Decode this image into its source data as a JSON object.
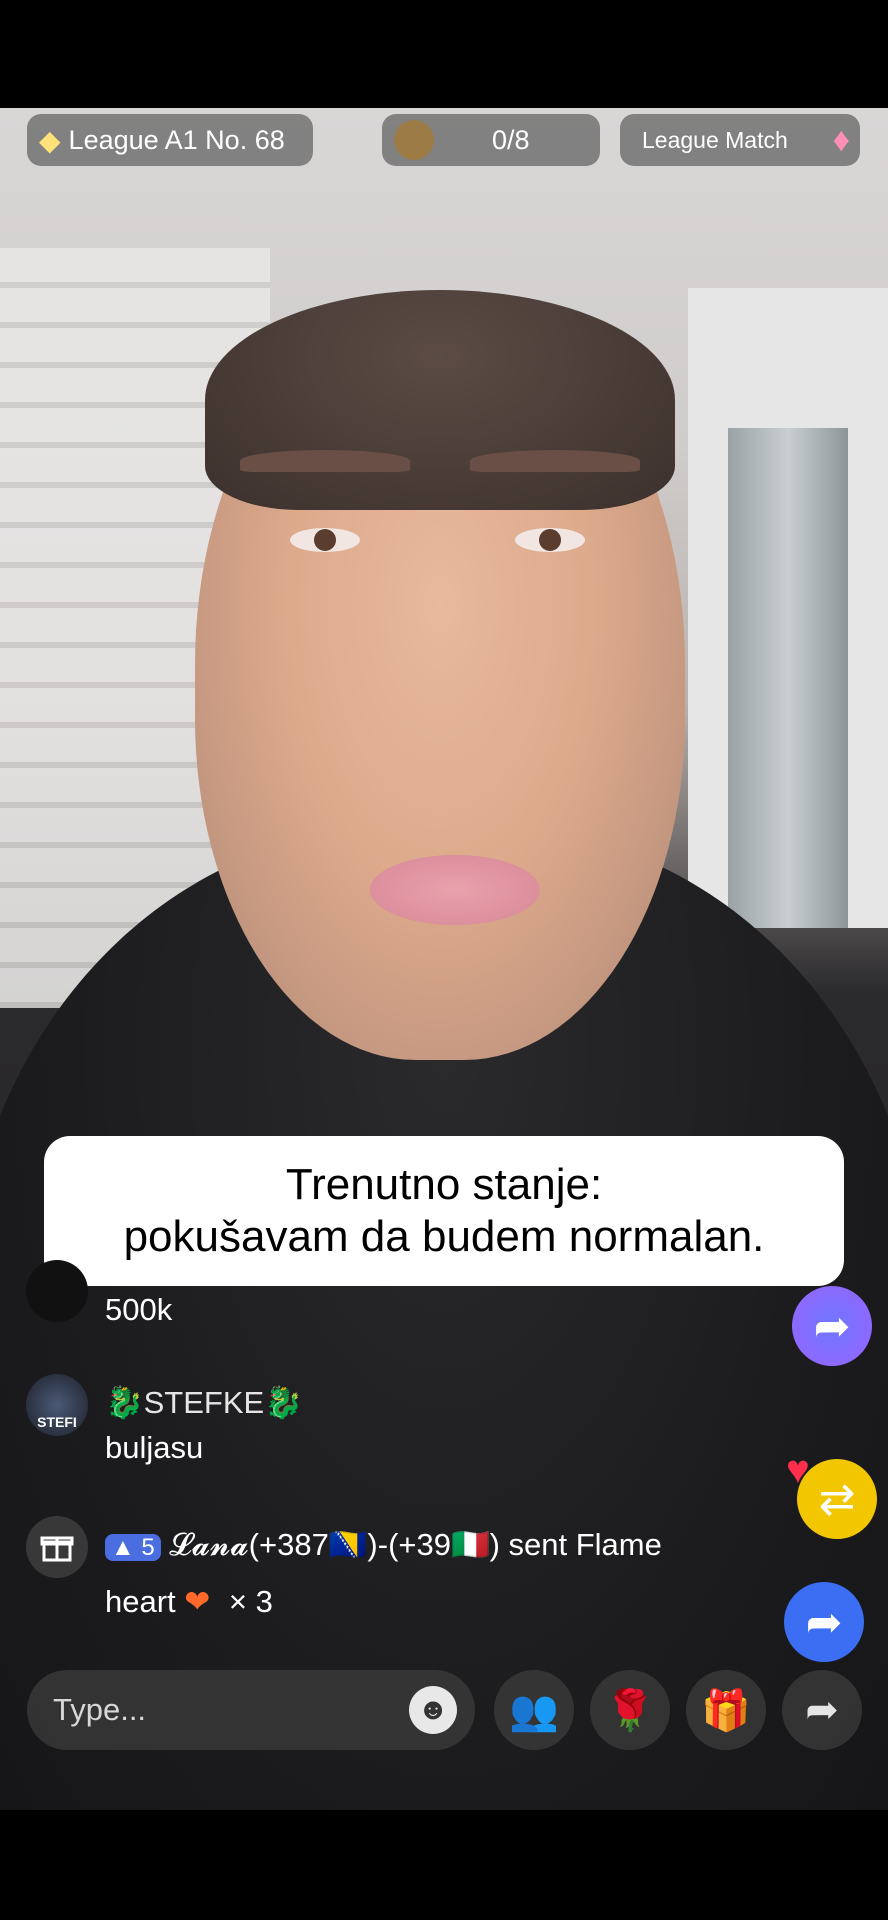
{
  "header": {
    "league_rank": "League A1 No. 68",
    "progress_text": "0/8",
    "league_match_label": "League Match"
  },
  "caption": {
    "line1": "Trenutno stanje:",
    "line2": "pokušavam da budem normalan."
  },
  "chat": [
    {
      "username": "",
      "message": "500k"
    },
    {
      "username": "STEFKE",
      "message": "buljasu",
      "avatar_text": "STEFI"
    },
    {
      "level": "5",
      "gift_line1": "𝓛𝓪𝓷𝓪(+387🇧🇦)-(+39🇮🇹) sent Flame",
      "gift_line2": "heart",
      "gift_count": "× 3"
    }
  ],
  "composer": {
    "placeholder": "Type..."
  },
  "icons": {
    "diamond": "diamond-icon",
    "league_badge": "league-badge-icon",
    "gift": "gift-icon",
    "emoji": "emoji-icon",
    "multi_guest": "multi-guest-icon",
    "rose": "rose-icon",
    "share": "share-icon",
    "repost": "repost-icon"
  },
  "colors": {
    "repost_yellow": "#f2c600",
    "share_blue": "#3b6ef3",
    "multi_guest": "#ff2e7a"
  }
}
